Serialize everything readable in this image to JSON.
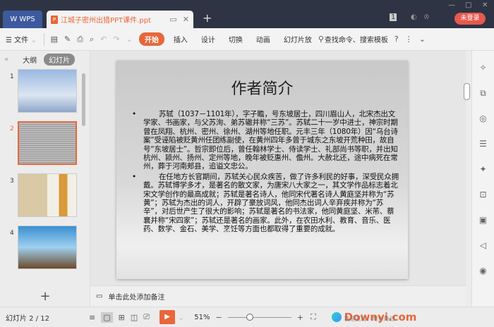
{
  "titlebar": {
    "app_tab": "WPS",
    "doc_tab": "江城子密州出猎PPT课件.ppt",
    "new_tab": "+",
    "login": "未登录",
    "badge": "1"
  },
  "toolbar": {
    "file": "文件",
    "start": "开始",
    "menus": [
      "插入",
      "设计",
      "切换",
      "动画",
      "幻灯片放"
    ],
    "search": "查找命令、搜索模板",
    "help": "?"
  },
  "left_panel": {
    "tab_outline": "大纲",
    "tab_slides": "幻灯片",
    "thumbnails": [
      "1",
      "2",
      "3",
      "4"
    ],
    "add": "+"
  },
  "slide": {
    "title": "作者简介",
    "paragraphs": [
      "苏轼（1037－1101年），字子瞻，号东坡居士，四川眉山人，北宋杰出文学家、书画家，与父苏洵、弟苏辙并称“三苏”。苏轼二十一岁中进士，神宗时期曾在凤翔、杭州、密州、徐州、湖州等地任职。元丰三年（1080年）因“乌台诗案”受诬陷被贬黄州任团练副使，在黄州四年多曾于城东之东坡开荒种田，故自号“东坡居士”。哲宗即位后，曾任翰林学士、侍读学士、礼部尚书等职，并出知杭州、颍州、扬州、定州等地，晚年被贬惠州、儋州。大赦北还，途中病死在常州，葬于河南郏县，追谥文忠公。",
      "在任地方长官期间，苏轼关心民众疾苦，做了许多利民的好事，深受民众拥戴。苏轼博学多才，是著名的散文家，为唐宋八大家之一，其文学作品标志着北宋文学创作的最高成就；苏轼是著名诗人，他同宋代著名诗人黄庭坚并称为“苏黄”；苏轼为杰出的词人，开辟了豪放词风，他同杰出词人辛弃疾并称为“苏辛”，对后世产生了很大的影响；苏轼是著名的书法家，他同黄庭坚、米芾、蔡襄并称“宋四家”；苏轼还是著名的画家。此外，在农田水利、教育、音乐、医药、数学、金石、美学、烹饪等方面也都取得了重要的成就。"
    ]
  },
  "notes": {
    "placeholder": "单击此处添加备注"
  },
  "status": {
    "slide_count": "幻灯片 2 / 12",
    "zoom": "51%",
    "watermark": "Downyi.com",
    "tip": "我是蓝打、帮你降低"
  },
  "colors": {
    "accent": "#e8673a",
    "titlebar": "#2f3444"
  }
}
